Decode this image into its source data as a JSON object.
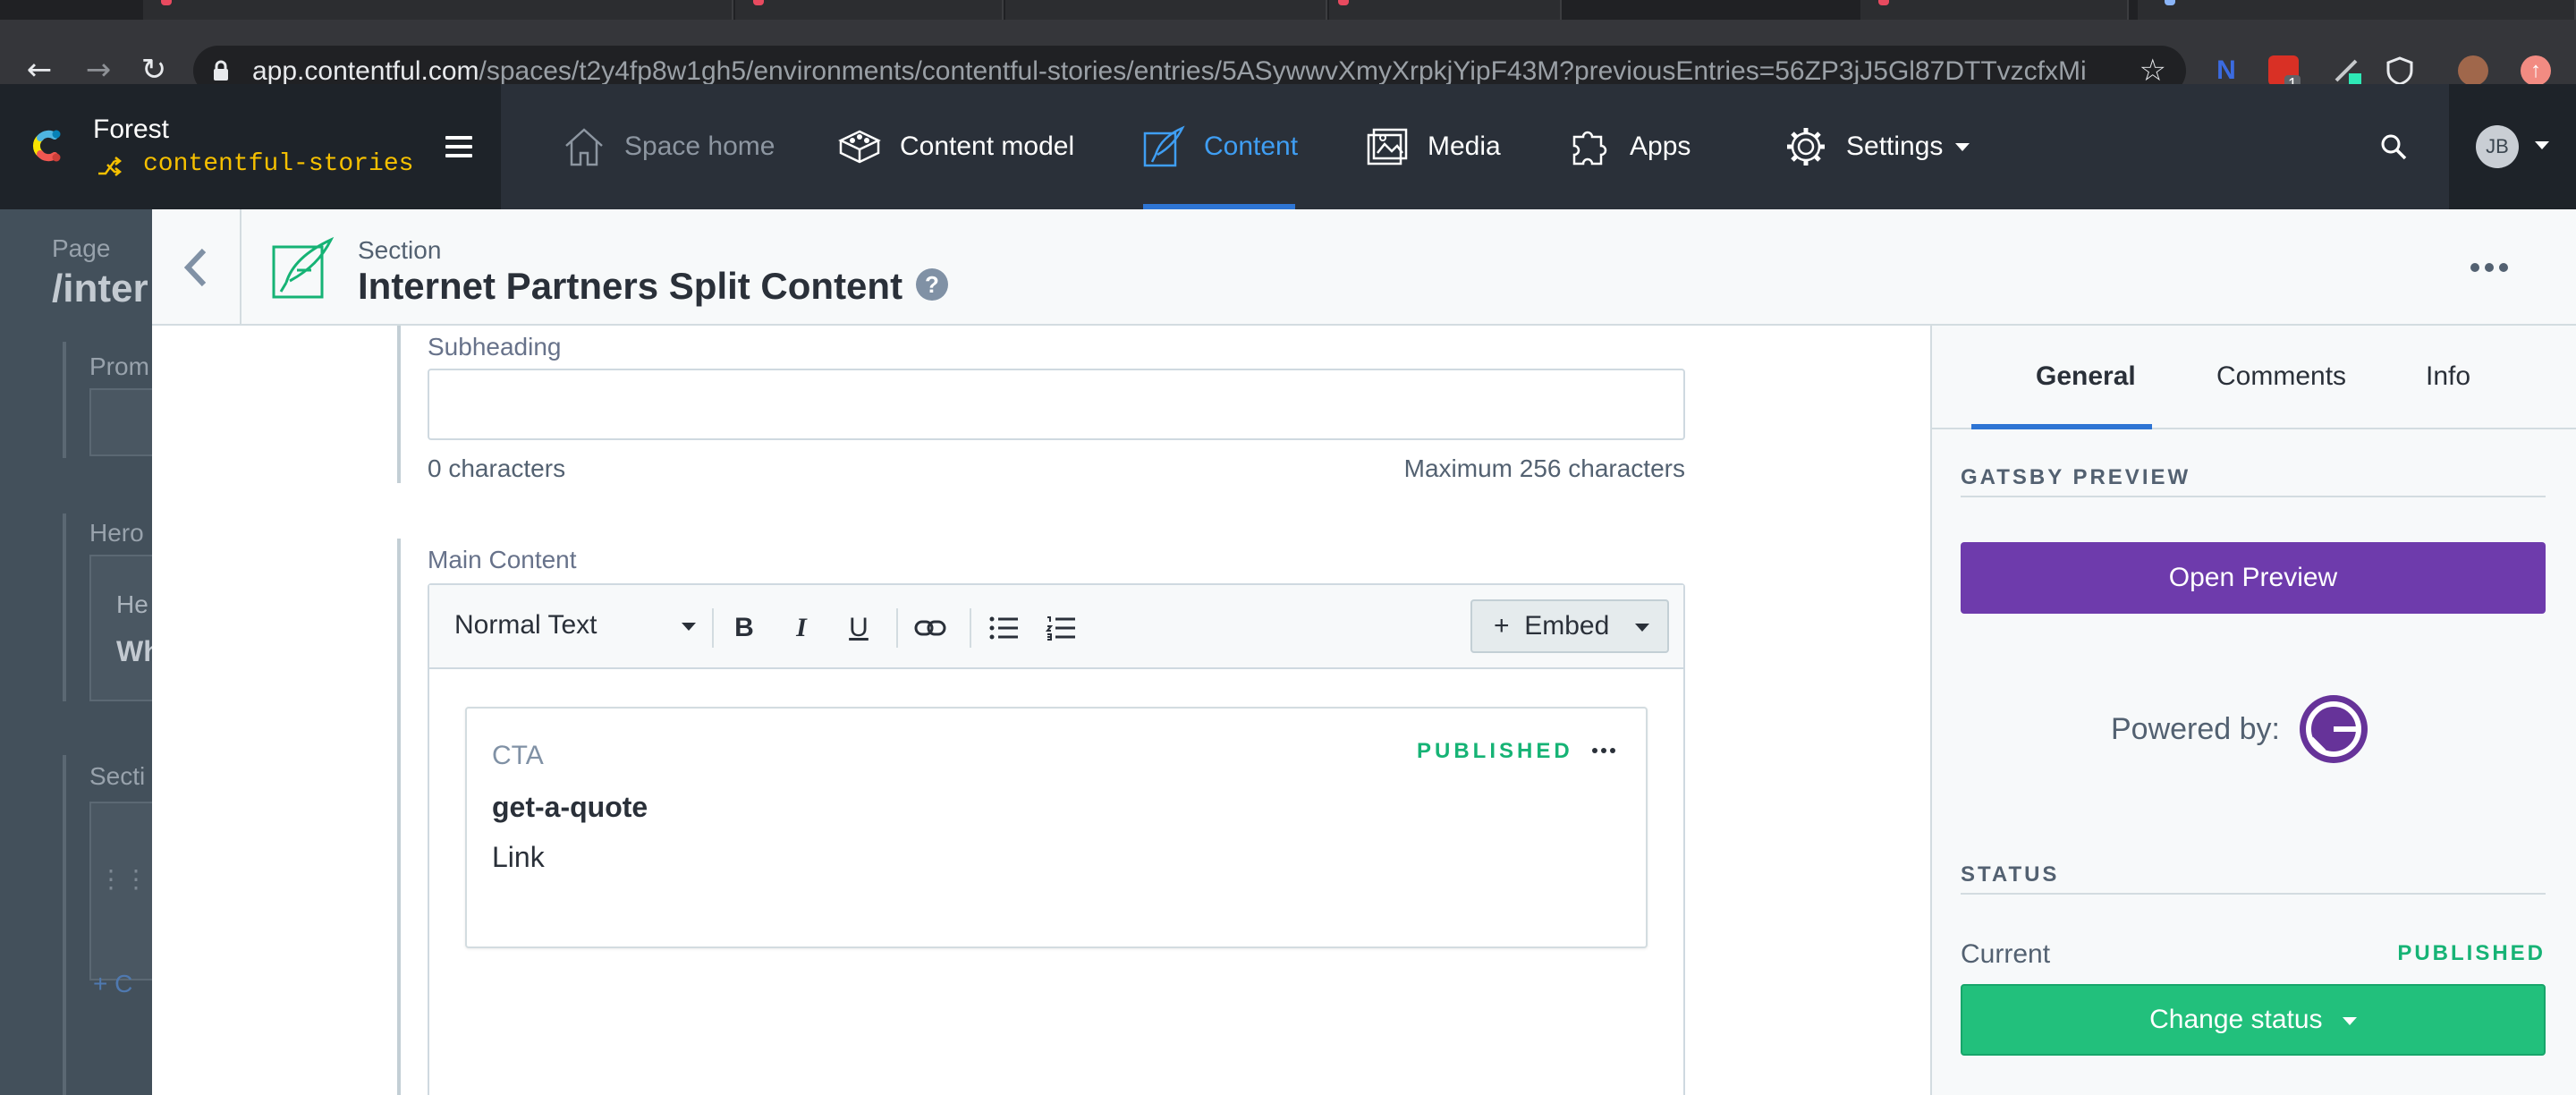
{
  "browser": {
    "url_host": "app.contentful.com",
    "url_path": "/spaces/t2y4fp8w1gh5/environments/contentful-stories/entries/5ASywwvXmyXrpkjYipF43M?previousEntries=56ZP3jJ5Gl87DTTvzcfxMi",
    "extension_badge": "1"
  },
  "app": {
    "space_name": "Forest",
    "environment": "contentful-stories",
    "nav": [
      {
        "label": "Space home",
        "icon": "home-icon"
      },
      {
        "label": "Content model",
        "icon": "content-model-icon"
      },
      {
        "label": "Content",
        "icon": "content-icon"
      },
      {
        "label": "Media",
        "icon": "media-icon"
      },
      {
        "label": "Apps",
        "icon": "apps-icon"
      },
      {
        "label": "Settings",
        "icon": "gear-icon"
      }
    ],
    "avatar_initials": "JB",
    "accent": "#2e75d4"
  },
  "background_page": {
    "label": "Page",
    "title": "/inter",
    "field_labels": [
      "Prom",
      "Hero",
      "Secti"
    ],
    "hero_lines": [
      "He",
      "Wh"
    ],
    "add_link": "+ C"
  },
  "entry": {
    "content_type": "Section",
    "title": "Internet Partners Split Content",
    "fields": {
      "subheading": {
        "label": "Subheading",
        "value": "",
        "count": "0 characters",
        "max": "Maximum 256 characters"
      },
      "main_content": {
        "label": "Main Content",
        "toolbar": {
          "style": "Normal Text",
          "bold": "B",
          "italic": "I",
          "underline": "U",
          "embed": "Embed"
        },
        "embedded_entry": {
          "type": "CTA",
          "status": "PUBLISHED",
          "title": "get-a-quote",
          "description": "Link"
        }
      }
    }
  },
  "sidebar": {
    "tabs": [
      "General",
      "Comments",
      "Info"
    ],
    "gatsby": {
      "heading": "GATSBY PREVIEW",
      "button": "Open Preview",
      "powered_by": "Powered by:"
    },
    "status": {
      "heading": "STATUS",
      "current_label": "Current",
      "current_value": "PUBLISHED",
      "button": "Change status"
    }
  },
  "colors": {
    "published": "#16b375",
    "preview_button": "#6e3bac",
    "status_button": "#22c07c"
  }
}
